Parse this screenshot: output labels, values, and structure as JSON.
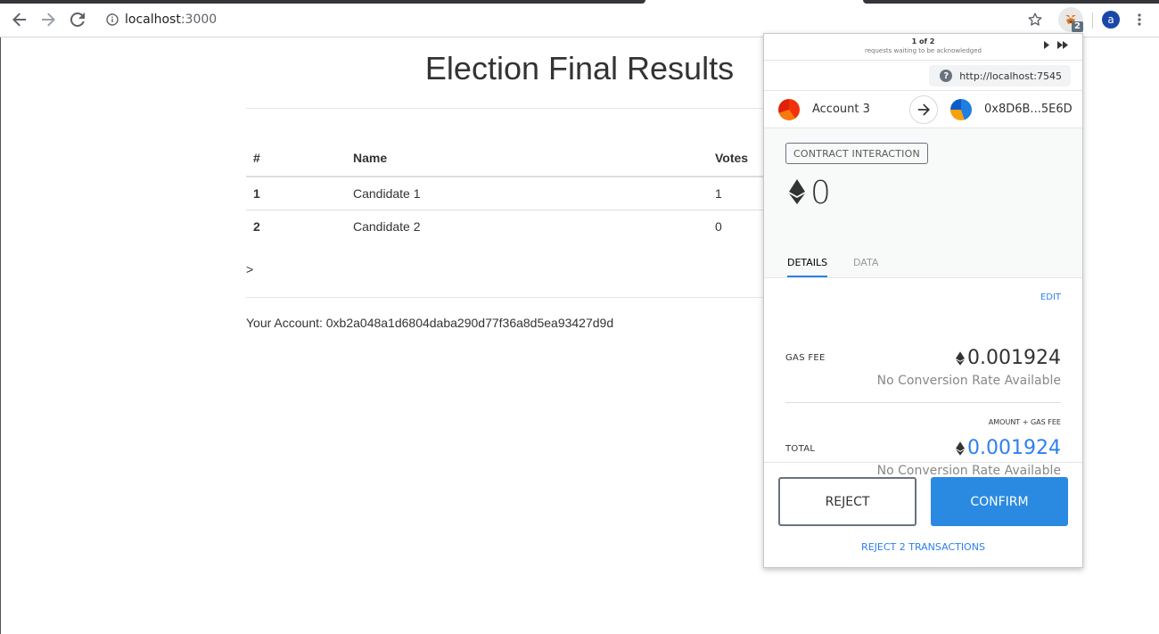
{
  "browser": {
    "url_host": "localhost",
    "url_port": ":3000",
    "extension_badge": "2",
    "avatar_letter": "a"
  },
  "page": {
    "title": "Election Final Results",
    "table": {
      "headers": [
        "#",
        "Name",
        "Votes"
      ],
      "rows": [
        {
          "id": "1",
          "name": "Candidate 1",
          "votes": "1"
        },
        {
          "id": "2",
          "name": "Candidate 2",
          "votes": "0"
        }
      ]
    },
    "stray_text": ">",
    "account_line": "Your Account: 0xb2a048a1d6804daba290d77f36a8d5ea93427d9d"
  },
  "metamask": {
    "request_count": "1 of 2",
    "request_sub": "requests waiting to be acknowledged",
    "origin": "http://localhost:7545",
    "from_account": "Account 3",
    "to_address": "0x8D6B...5E6D",
    "action_label": "CONTRACT INTERACTION",
    "amount": "0",
    "tabs": [
      "DETAILS",
      "DATA"
    ],
    "edit_label": "EDIT",
    "gas_fee_label": "GAS FEE",
    "gas_fee_value": "0.001924",
    "no_rate": "No Conversion Rate Available",
    "amount_gas_label": "AMOUNT + GAS FEE",
    "total_label": "TOTAL",
    "total_value": "0.001924",
    "reject_label": "REJECT",
    "confirm_label": "CONFIRM",
    "reject_all_label": "REJECT 2 TRANSACTIONS",
    "colors": {
      "accent": "#2f80ed",
      "confirm_bg": "#2a8ae1"
    }
  }
}
